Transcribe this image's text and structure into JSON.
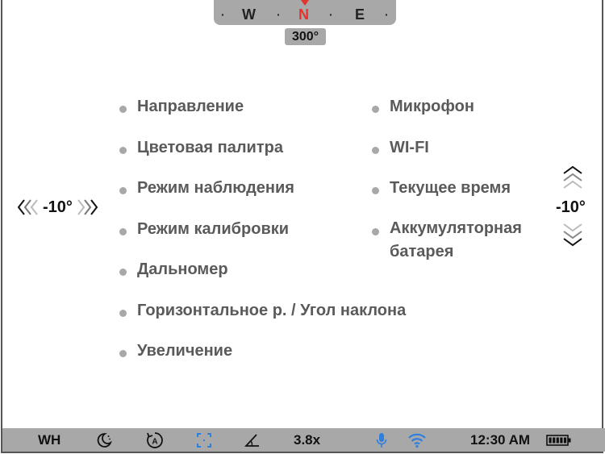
{
  "compass": {
    "directions": [
      "W",
      "N",
      "E"
    ],
    "heading": "300°",
    "colors": {
      "north": "#e2342f",
      "bar": "#a8a8a8"
    }
  },
  "menu": {
    "left": [
      "Направление",
      "Цветовая палитра",
      "Режим наблюдения",
      "Режим калибровки",
      "Дальномер",
      "Горизонтальное р. / Угол наклона",
      "Увеличение"
    ],
    "right": [
      "Микрофон",
      "WI-FI",
      "Текущее время",
      "Аккумуляторная батарея"
    ]
  },
  "tilt_indicator": {
    "value": "-10°",
    "icons": [
      "chevron-left-triple-icon",
      "chevron-right-triple-icon"
    ]
  },
  "elevation_indicator": {
    "value": "-10°",
    "icons": [
      "chevron-up-triple-icon",
      "chevron-down-triple-icon"
    ]
  },
  "status_bar": {
    "palette": "WH",
    "mode_icon": "moon-icon",
    "calibration_icon": "auto-calibration-icon",
    "rangefinder_icon": "rangefinder-icon",
    "angle_icon": "angle-icon",
    "zoom": "3.8x",
    "mic_icon": "microphone-icon",
    "wifi_icon": "wifi-icon",
    "time": "12:30 AM",
    "battery_icon": "battery-icon",
    "battery_level": 1.0,
    "colors": {
      "accent": "#2f7fe0"
    }
  }
}
